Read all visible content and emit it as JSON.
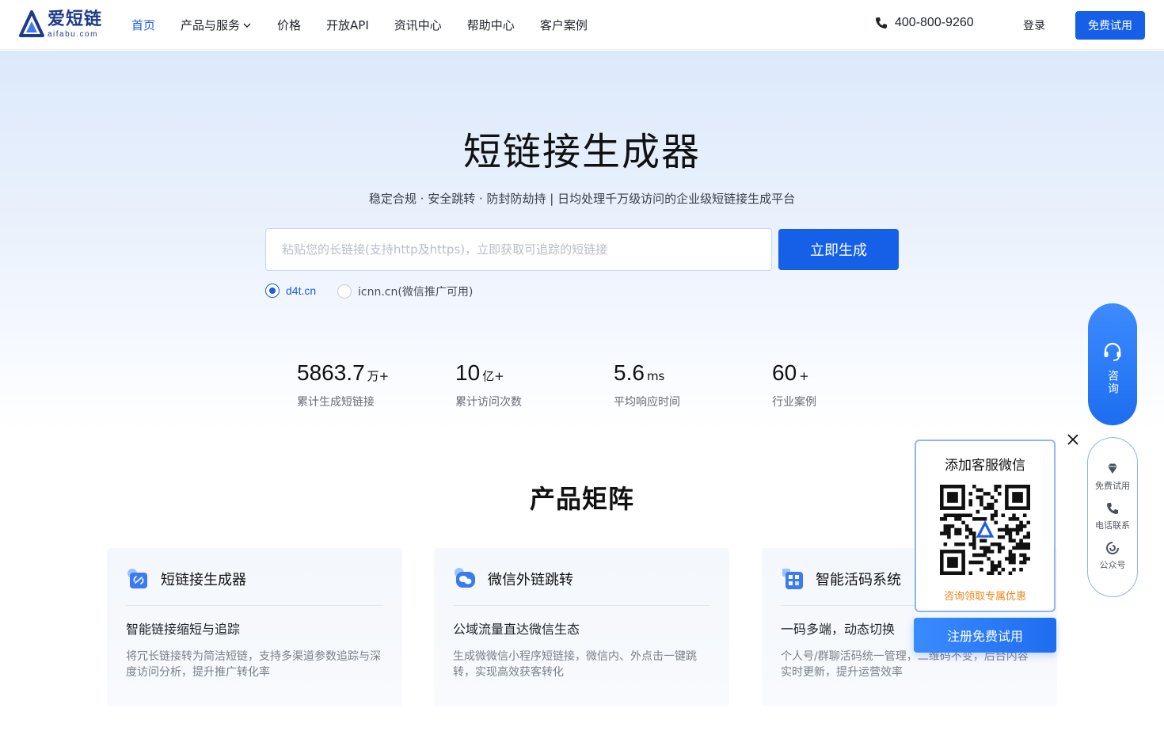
{
  "brand": {
    "name_cn": "爱短链",
    "domain": "aifabu.com",
    "color": "#1f3a8a"
  },
  "nav": {
    "items": [
      {
        "label": "首页",
        "active": true
      },
      {
        "label": "产品与服务",
        "active": false,
        "dropdown": true
      },
      {
        "label": "价格",
        "active": false
      },
      {
        "label": "开放API",
        "active": false
      },
      {
        "label": "资讯中心",
        "active": false
      },
      {
        "label": "帮助中心",
        "active": false
      },
      {
        "label": "客户案例",
        "active": false
      }
    ]
  },
  "header": {
    "phone": "400-800-9260",
    "login_label": "登录",
    "free_trial_label": "免费试用",
    "accent_color": "#1660e8"
  },
  "hero": {
    "title": "短链接生成器",
    "subtitle": "稳定合规 · 安全跳转 · 防封防劫持 | 日均处理千万级访问的企业级短链接生成平台",
    "input_placeholder": "粘贴您的长链接(支持http及https)，立即获取可追踪的短链接",
    "input_value": "",
    "generate_label": "立即生成",
    "domains": [
      {
        "label": "d4t.cn",
        "selected": true
      },
      {
        "label": "icnn.cn(微信推广可用)",
        "selected": false
      }
    ]
  },
  "stats": [
    {
      "value": "5863.7",
      "unit": "万+",
      "label": "累计生成短链接"
    },
    {
      "value": "10",
      "unit": "亿+",
      "label": "累计访问次数"
    },
    {
      "value": "5.6",
      "unit": "ms",
      "label": "平均响应时间"
    },
    {
      "value": "60",
      "unit": "+",
      "label": "行业案例"
    }
  ],
  "products": {
    "section_title": "产品矩阵",
    "cards": [
      {
        "icon": "link-icon",
        "title": "短链接生成器",
        "subtitle": "智能链接缩短与追踪",
        "desc": "将冗长链接转为简洁短链，支持多渠道参数追踪与深度访问分析，提升推广转化率"
      },
      {
        "icon": "wechat-icon",
        "title": "微信外链跳转",
        "subtitle": "公域流量直达微信生态",
        "desc": "生成微微信小程序短链接，微信内、外点击一键跳转，实现高效获客转化"
      },
      {
        "icon": "qrcode-icon",
        "title": "智能活码系统",
        "subtitle": "一码多端，动态切换",
        "desc": "个人号/群聊活码统一管理，二维码不变，后台内容实时更新，提升运营效率"
      }
    ]
  },
  "sidebar": {
    "consult_label": "咨询",
    "items": [
      {
        "icon": "diamond-icon",
        "label": "免费试用"
      },
      {
        "icon": "phone-icon",
        "label": "电话联系"
      },
      {
        "icon": "official-account-icon",
        "label": "公众号"
      }
    ]
  },
  "qr_popup": {
    "title": "添加客服微信",
    "promo": "咨询领取专属优惠",
    "register_label": "注册免费试用",
    "promo_color": "#f0871b"
  }
}
